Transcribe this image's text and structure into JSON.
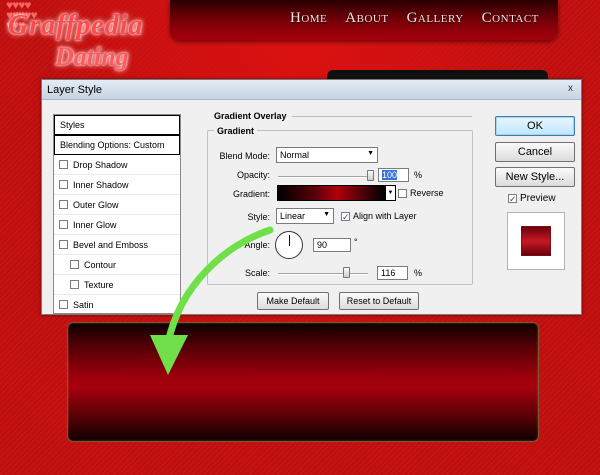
{
  "site": {
    "logo_line1": "Graffpedia",
    "logo_line2": "Dating",
    "nav": [
      "Home",
      "About",
      "Gallery",
      "Contact"
    ]
  },
  "dialog": {
    "title": "Layer Style",
    "close_glyph": "x",
    "styles_list": {
      "header": "Styles",
      "blending": "Blending Options: Custom",
      "items": [
        "Drop Shadow",
        "Inner Shadow",
        "Outer Glow",
        "Inner Glow",
        "Bevel and Emboss",
        "Contour",
        "Texture",
        "Satin"
      ]
    },
    "section_title": "Gradient Overlay",
    "group_title": "Gradient",
    "fields": {
      "blend_mode_label": "Blend Mode:",
      "blend_mode_value": "Normal",
      "opacity_label": "Opacity:",
      "opacity_value": "100",
      "opacity_unit": "%",
      "gradient_label": "Gradient:",
      "reverse_label": "Reverse",
      "reverse_checked": false,
      "style_label": "Style:",
      "style_value": "Linear",
      "align_label": "Align with Layer",
      "align_checked": true,
      "angle_label": "Angle:",
      "angle_value": "90",
      "angle_unit": "°",
      "scale_label": "Scale:",
      "scale_value": "116",
      "scale_unit": "%"
    },
    "buttons": {
      "ok": "OK",
      "cancel": "Cancel",
      "new_style": "New Style...",
      "preview_label": "Preview",
      "preview_checked": true,
      "make_default": "Make Default",
      "reset_default": "Reset to Default"
    }
  },
  "colors": {
    "page_red": "#c40f0f",
    "arrow_green": "#6fe04a",
    "nav_text": "#f3e6e6"
  }
}
